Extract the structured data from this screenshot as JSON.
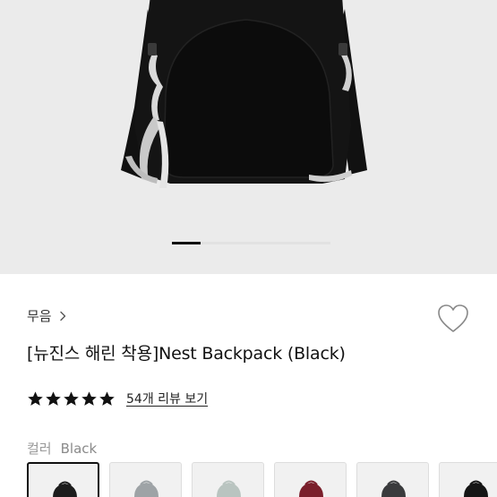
{
  "gallery": {
    "current_slide_fraction": 0.08
  },
  "product": {
    "brand": "무음",
    "title": "[뉴진스 해린 착용]Nest Backpack (Black)",
    "rating_stars": 5,
    "review_link": "54개 리뷰 보기",
    "color_label": "컬러",
    "color_value": "Black"
  },
  "swatches": [
    {
      "color": "#1c1c1c",
      "selected": true
    },
    {
      "color": "#9ea3a6",
      "selected": false
    },
    {
      "color": "#b9c4c0",
      "selected": false
    },
    {
      "color": "#7a1f2b",
      "selected": false
    },
    {
      "color": "#3a3b3d",
      "selected": false
    },
    {
      "color": "#151515",
      "selected": false
    }
  ],
  "colors": {
    "star": "#111111",
    "accent": "#111111"
  }
}
